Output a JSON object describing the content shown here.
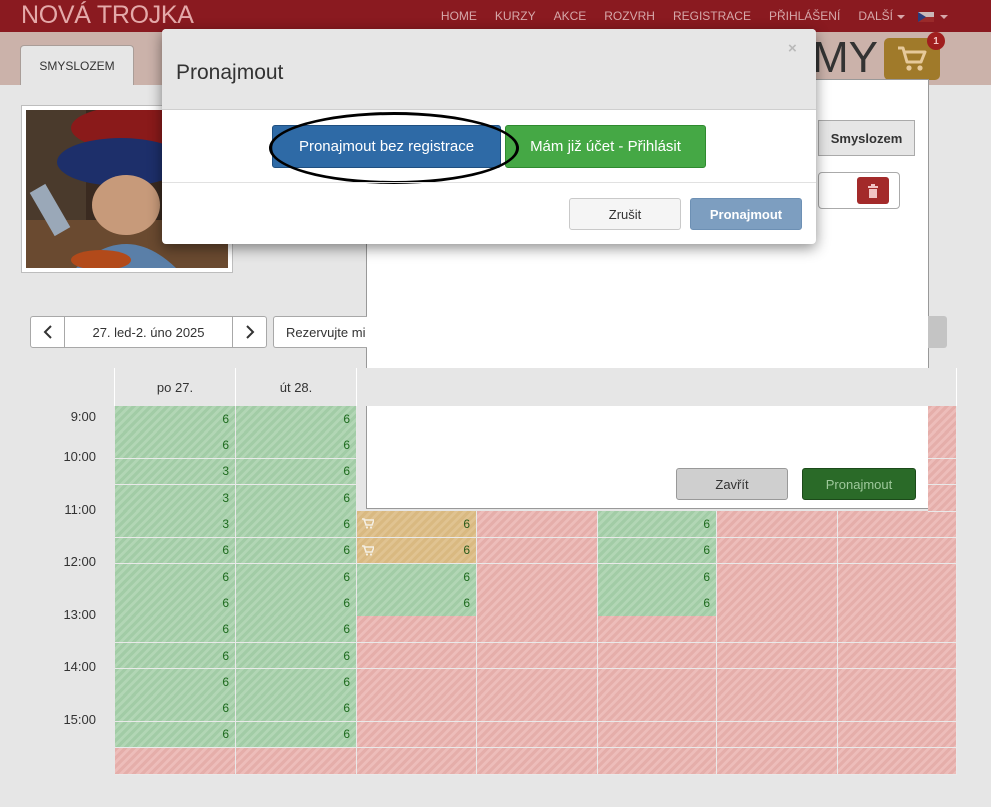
{
  "header": {
    "brand": "NOVÁ TROJKA",
    "nav": [
      "HOME",
      "KURZY",
      "AKCE",
      "ROZVRH",
      "REGISTRACE",
      "PŘIHLÁŠENÍ",
      "DALŠÍ"
    ],
    "language_flag": "cz-flag-icon"
  },
  "subheader": {
    "tab": "SMYSLOZEM",
    "title_fragment": "MY",
    "cart_count": "1"
  },
  "side_panel": {
    "heading": "Smyslozem",
    "close_button": "Zavřít",
    "rent_button": "Pronajmout"
  },
  "calendar": {
    "date_range": "27. led-2. úno 2025",
    "reserve_placeholder": "Rezervujte mi",
    "days": [
      "po 27.",
      "út 28."
    ],
    "times": [
      "9:00",
      "10:00",
      "11:00",
      "12:00",
      "13:00",
      "14:00",
      "15:00"
    ],
    "col1_values": [
      "6",
      "6",
      "3",
      "3",
      "3",
      "6",
      "6",
      "6",
      "6",
      "6",
      "6",
      "6",
      "6"
    ],
    "col2_values": [
      "6",
      "6",
      "6",
      "6",
      "6",
      "6",
      "6",
      "6",
      "6",
      "6",
      "6",
      "6",
      "6"
    ],
    "col3_values": [
      "6",
      "6",
      "6",
      "6"
    ],
    "col5_values": [
      "6",
      "6",
      "6",
      "6"
    ]
  },
  "modal": {
    "title": "Pronajmout",
    "close": "×",
    "anon_button": "Pronajmout bez registrace",
    "login_button": "Mám již účet - Přihlásit",
    "cancel_button": "Zrušit",
    "rent_button": "Pronajmout"
  }
}
